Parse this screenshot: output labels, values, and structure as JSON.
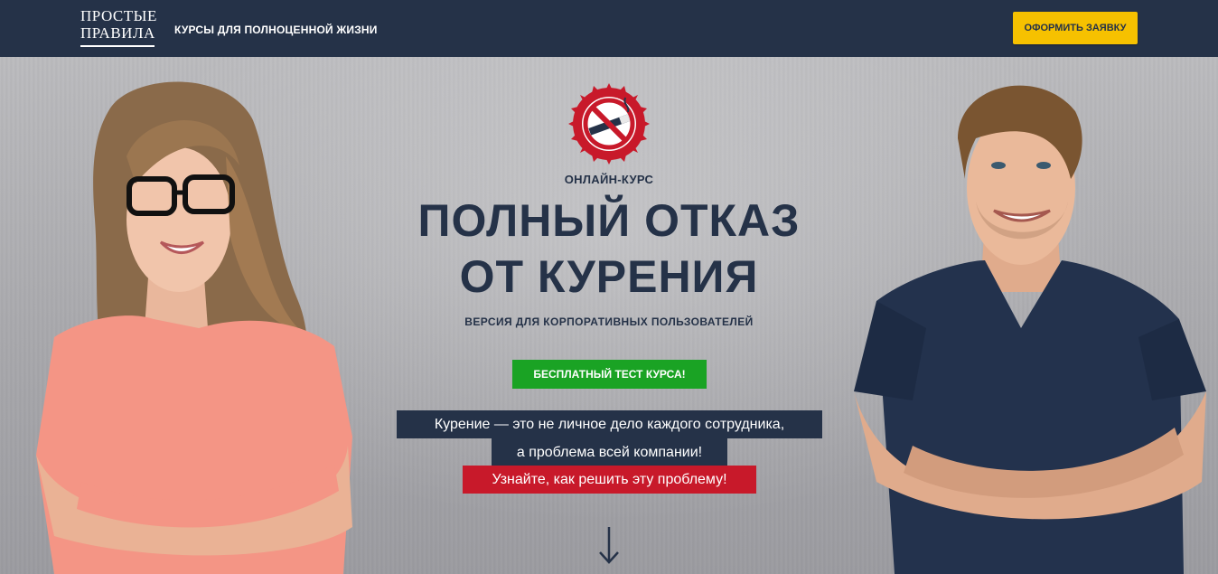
{
  "header": {
    "logo_line1": "ПРОСТЫЕ",
    "logo_line2": "ПРАВИЛА",
    "tagline": "КУРСЫ ДЛЯ ПОЛНОЦЕННОЙ ЖИЗНИ",
    "cta_label": "ОФОРМИТЬ ЗАЯВКУ"
  },
  "hero": {
    "icon": "no-smoking-icon",
    "subtitle": "ОНЛАЙН-КУРС",
    "title_line1": "ПОЛНЫЙ ОТКАЗ",
    "title_line2": "ОТ КУРЕНИЯ",
    "version": "ВЕРСИЯ ДЛЯ КОРПОРАТИВНЫХ ПОЛЬЗОВАТЕЛЕЙ",
    "free_test_label": "БЕСПЛАТНЫЙ ТЕСТ КУРСА!",
    "message_line1": "Курение — это не личное дело каждого сотрудника,",
    "message_line2": "а проблема всей компании!",
    "message_line3": "Узнайте, как решить эту проблему!",
    "scroll_icon": "arrow-down-icon"
  },
  "colors": {
    "header_bg": "#253248",
    "accent_yellow": "#f6c100",
    "accent_green": "#1aa324",
    "accent_red": "#c8192a"
  }
}
